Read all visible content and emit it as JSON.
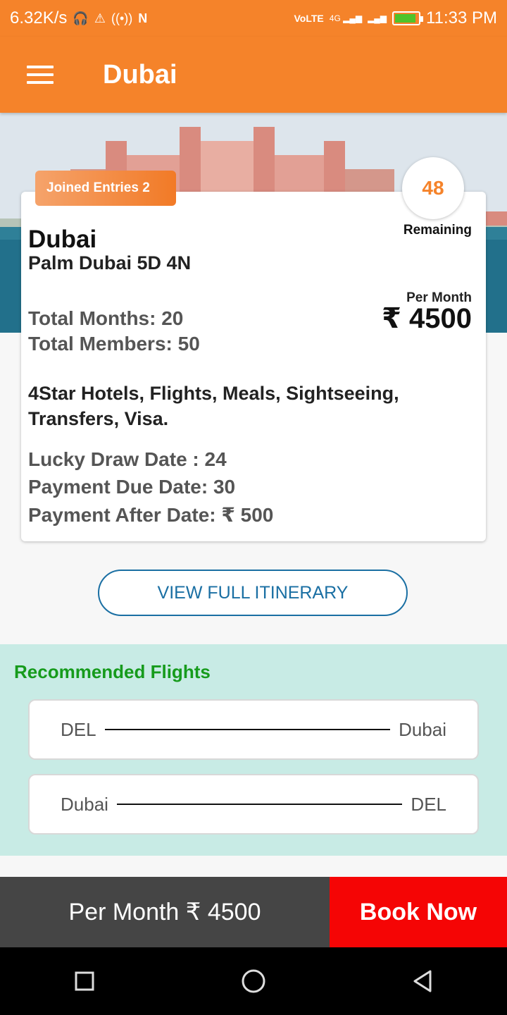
{
  "status_bar": {
    "speed": "6.32K/s",
    "time": "11:33 PM",
    "network_labels": [
      "4G",
      "4G"
    ]
  },
  "app_bar": {
    "title": "Dubai"
  },
  "card": {
    "joined_entries": "Joined Entries 2",
    "remaining_count": "48",
    "remaining_label": "Remaining",
    "title": "Dubai",
    "subtitle": "Palm Dubai 5D 4N",
    "per_month_label": "Per Month",
    "per_month_price": "₹ 4500",
    "total_months": "Total Months: 20",
    "total_members": "Total Members: 50",
    "inclusions": "4Star Hotels, Flights, Meals, Sightseeing, Transfers, Visa.",
    "lucky_draw_date": "Lucky Draw Date : 24",
    "payment_due_date": "Payment Due Date: 30",
    "payment_after_date": "Payment After Date: ₹  500"
  },
  "itinerary_button": "VIEW FULL ITINERARY",
  "flights": {
    "heading": "Recommended Flights",
    "items": [
      {
        "from": "DEL",
        "to": "Dubai"
      },
      {
        "from": "Dubai",
        "to": "DEL"
      }
    ]
  },
  "bottom_bar": {
    "price_text": "Per Month ₹ 4500",
    "book_label": "Book Now"
  },
  "colors": {
    "primary": "#f5832a",
    "book": "#f50505",
    "flights_bg": "#c8ebe5",
    "heading_green": "#169b1c",
    "itinerary_blue": "#1a6fa3"
  },
  "icons": [
    "menu-icon",
    "headphones-icon",
    "warning-icon",
    "hotspot-icon",
    "nfc-icon",
    "volte-icon",
    "signal-icon",
    "battery-icon",
    "recents-icon",
    "home-icon",
    "back-icon"
  ]
}
